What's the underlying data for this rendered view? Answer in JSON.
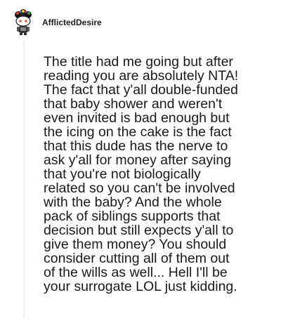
{
  "comment": {
    "author": "AfflictedDesire",
    "avatar_icon": "snoo-avatar-icon",
    "body_lines": [
      "The title had me going but after",
      "reading you are absolutely NTA!",
      "The fact that y'all double-funded",
      "that baby shower and weren't",
      "even invited is bad enough but",
      "the icing on the cake is the fact",
      "that this dude has the nerve to",
      "ask y'all for money after saying",
      "that you're not biologically",
      "related so you can't be involved",
      "with the baby? And the whole",
      "pack of siblings supports that",
      "decision but still expects y'all to",
      "give them money? You should",
      "consider cutting all of them out",
      "of the wills as well... Hell I'll be",
      "your surrogate LOL just kidding."
    ]
  }
}
